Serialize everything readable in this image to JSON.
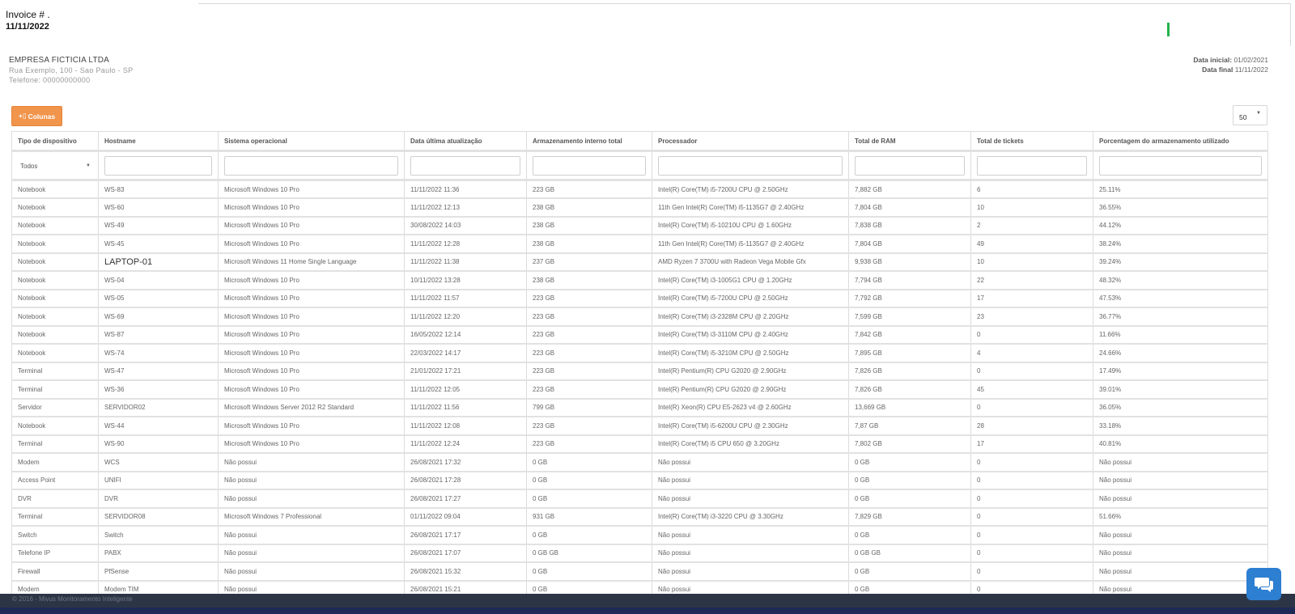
{
  "invoice": {
    "label": "Invoice # .",
    "date": "11/11/2022"
  },
  "company": {
    "name": "EMPRESA FICTICIA LTDA",
    "address": "Rua Exemplo, 100 - Sao Paulo - SP",
    "phone": "Telefone: 00000000000"
  },
  "dates": {
    "start_label": "Data inicial:",
    "start_value": "01/02/2021",
    "end_label": "Data final",
    "end_value": "11/11/2022"
  },
  "toolbar": {
    "columns_label": "Colunas",
    "columns_icon": "columns-icon",
    "page_size": "50"
  },
  "table": {
    "headers": [
      "Tipo de dispositivo",
      "Hostname",
      "Sistema operacional",
      "Data última atualização",
      "Armazenamento interno total",
      "Processador",
      "Total de RAM",
      "Total de tickets",
      "Porcentagem do armazenamento utilizado"
    ],
    "type_filter": "Todos",
    "rows": [
      [
        "Notebook",
        "WS-83",
        "Microsoft Windows 10 Pro",
        "11/11/2022 11:36",
        "223 GB",
        "Intel(R) Core(TM) i5-7200U CPU @ 2.50GHz",
        "7,882 GB",
        "6",
        "25.11%"
      ],
      [
        "Notebook",
        "WS-60",
        "Microsoft Windows 10 Pro",
        "11/11/2022 12:13",
        "238 GB",
        "11th Gen Intel(R) Core(TM) i5-1135G7 @ 2.40GHz",
        "7,804 GB",
        "10",
        "36.55%"
      ],
      [
        "Notebook",
        "WS-49",
        "Microsoft Windows 10 Pro",
        "30/08/2022 14:03",
        "238 GB",
        "Intel(R) Core(TM) i5-10210U CPU @ 1.60GHz",
        "7,838 GB",
        "2",
        "44.12%"
      ],
      [
        "Notebook",
        "WS-45",
        "Microsoft Windows 10 Pro",
        "11/11/2022 12:28",
        "238 GB",
        "11th Gen Intel(R) Core(TM) i5-1135G7 @ 2.40GHz",
        "7,804 GB",
        "49",
        "38.24%"
      ],
      [
        "Notebook",
        "LAPTOP-01",
        "Microsoft Windows 11 Home Single Language",
        "11/11/2022 11:38",
        "237 GB",
        "AMD Ryzen 7 3700U with Radeon Vega Mobile Gfx",
        "9,938 GB",
        "10",
        "39.24%"
      ],
      [
        "Notebook",
        "WS-04",
        "Microsoft Windows 10 Pro",
        "10/11/2022 13:28",
        "238 GB",
        "Intel(R) Core(TM) i3-1005G1 CPU @ 1.20GHz",
        "7,794 GB",
        "22",
        "48.32%"
      ],
      [
        "Notebook",
        "WS-05",
        "Microsoft Windows 10 Pro",
        "11/11/2022 11:57",
        "223 GB",
        "Intel(R) Core(TM) i5-7200U CPU @ 2.50GHz",
        "7,792 GB",
        "17",
        "47.53%"
      ],
      [
        "Notebook",
        "WS-69",
        "Microsoft Windows 10 Pro",
        "11/11/2022 12:20",
        "223 GB",
        "Intel(R) Core(TM) i3-2328M CPU @ 2.20GHz",
        "7,599 GB",
        "23",
        "36.77%"
      ],
      [
        "Notebook",
        "WS-87",
        "Microsoft Windows 10 Pro",
        "16/05/2022 12:14",
        "223 GB",
        "Intel(R) Core(TM) i3-3110M CPU @ 2.40GHz",
        "7,842 GB",
        "0",
        "11.66%"
      ],
      [
        "Notebook",
        "WS-74",
        "Microsoft Windows 10 Pro",
        "22/03/2022 14:17",
        "223 GB",
        "Intel(R) Core(TM) i5-3210M CPU @ 2.50GHz",
        "7,895 GB",
        "4",
        "24.66%"
      ],
      [
        "Terminal",
        "WS-47",
        "Microsoft Windows 10 Pro",
        "21/01/2022 17:21",
        "223 GB",
        "Intel(R) Pentium(R) CPU G2020 @ 2.90GHz",
        "7,826 GB",
        "0",
        "17.49%"
      ],
      [
        "Terminal",
        "WS-36",
        "Microsoft Windows 10 Pro",
        "11/11/2022 12:05",
        "223 GB",
        "Intel(R) Pentium(R) CPU G2020 @ 2.90GHz",
        "7,826 GB",
        "45",
        "39.01%"
      ],
      [
        "Servidor",
        "SERVIDOR02",
        "Microsoft Windows Server 2012 R2 Standard",
        "11/11/2022 11:56",
        "799 GB",
        "Intel(R) Xeon(R) CPU E5-2623 v4 @ 2.60GHz",
        "13,669 GB",
        "0",
        "36.05%"
      ],
      [
        "Notebook",
        "WS-44",
        "Microsoft Windows 10 Pro",
        "11/11/2022 12:08",
        "223 GB",
        "Intel(R) Core(TM) i5-6200U CPU @ 2.30GHz",
        "7,87 GB",
        "28",
        "33.18%"
      ],
      [
        "Terminal",
        "WS-90",
        "Microsoft Windows 10 Pro",
        "11/11/2022 12:24",
        "223 GB",
        "Intel(R) Core(TM) i5 CPU 650 @ 3.20GHz",
        "7,802 GB",
        "17",
        "40.81%"
      ],
      [
        "Modem",
        "WCS",
        "Não possui",
        "26/08/2021 17:32",
        "0 GB",
        "Não possui",
        "0 GB",
        "0",
        "Não possui"
      ],
      [
        "Access Point",
        "UNIFI",
        "Não possui",
        "26/08/2021 17:28",
        "0 GB",
        "Não possui",
        "0 GB",
        "0",
        "Não possui"
      ],
      [
        "DVR",
        "DVR",
        "Não possui",
        "26/08/2021 17:27",
        "0 GB",
        "Não possui",
        "0 GB",
        "0",
        "Não possui"
      ],
      [
        "Terminal",
        "SERVIDOR08",
        "Microsoft Windows 7 Professional",
        "01/11/2022 09:04",
        "931 GB",
        "Intel(R) Core(TM) i3-3220 CPU @ 3.30GHz",
        "7,829 GB",
        "0",
        "51.66%"
      ],
      [
        "Switch",
        "Switch",
        "Não possui",
        "26/08/2021 17:17",
        "0 GB",
        "Não possui",
        "0 GB",
        "0",
        "Não possui"
      ],
      [
        "Telefone IP",
        "PABX",
        "Não possui",
        "26/08/2021 17:07",
        "0 GB GB",
        "Não possui",
        "0 GB GB",
        "0",
        "Não possui"
      ],
      [
        "Firewall",
        "PfSense",
        "Não possui",
        "26/08/2021 15:32",
        "0 GB",
        "Não possui",
        "0 GB",
        "0",
        "Não possui"
      ],
      [
        "Modem",
        "Modem TIM",
        "Não possui",
        "26/08/2021 15:21",
        "0 GB",
        "Não possui",
        "0 GB",
        "0",
        "Não possui"
      ]
    ]
  },
  "footer": {
    "text": "© 2016 - Mivus Monitoramento Inteligente"
  },
  "chat": {
    "icon": "chat-icon"
  },
  "colors": {
    "accent": "#f0954b",
    "status": "#22b14c",
    "chat": "#2d7fd1",
    "footer": "#2c3545"
  }
}
